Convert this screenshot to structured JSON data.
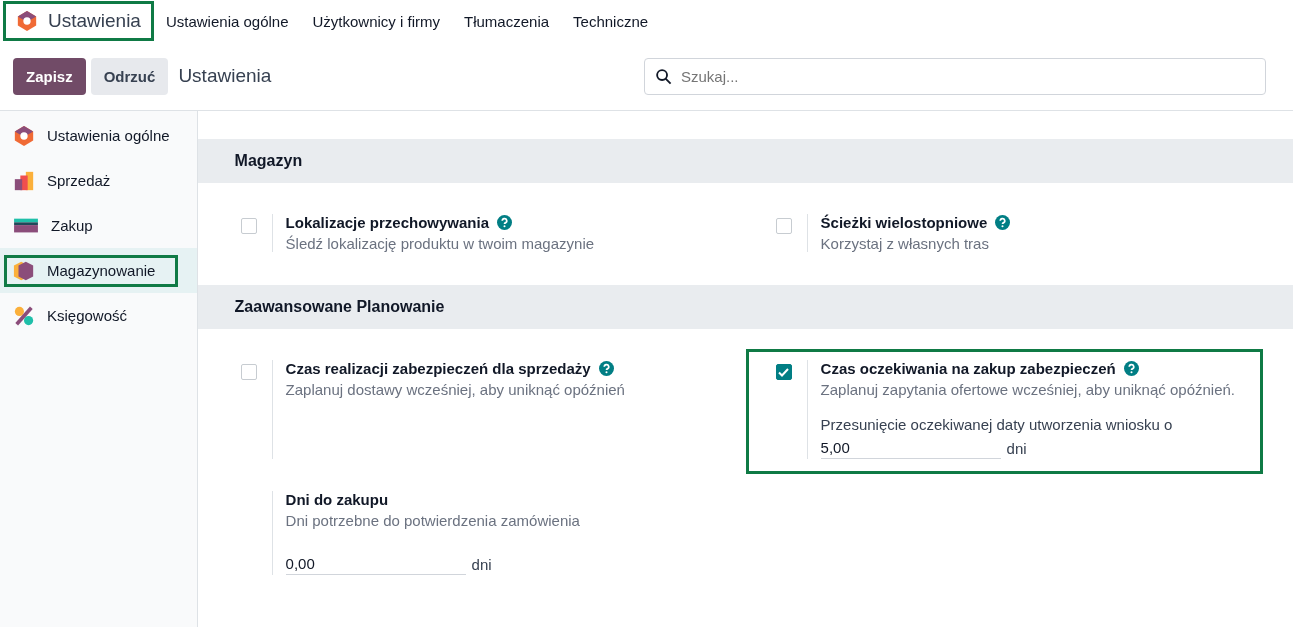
{
  "app": {
    "title": "Ustawienia",
    "highlighted": true
  },
  "menu": [
    {
      "label": "Ustawienia ogólne"
    },
    {
      "label": "Użytkownicy i firmy"
    },
    {
      "label": "Tłumaczenia"
    },
    {
      "label": "Techniczne"
    }
  ],
  "buttons": {
    "save": "Zapisz",
    "discard": "Odrzuć"
  },
  "breadcrumb": "Ustawienia",
  "search": {
    "placeholder": "Szukaj..."
  },
  "sidebar": {
    "items": [
      {
        "label": "Ustawienia ogólne",
        "kind": "general",
        "selected": false,
        "highlighted": false
      },
      {
        "label": "Sprzedaż",
        "kind": "sales",
        "selected": false,
        "highlighted": false
      },
      {
        "label": "Zakup",
        "kind": "purchase",
        "selected": false,
        "highlighted": false
      },
      {
        "label": "Magazynowanie",
        "kind": "inventory",
        "selected": true,
        "highlighted": true
      },
      {
        "label": "Księgowość",
        "kind": "accounting",
        "selected": false,
        "highlighted": false
      }
    ]
  },
  "sections": [
    {
      "title": "Magazyn",
      "settings": [
        {
          "kind": "checkbox",
          "checked": false,
          "highlighted": false,
          "help": true,
          "title": "Lokalizacje przechowywania",
          "description": "Śledź lokalizację produktu w twoim magazynie"
        },
        {
          "kind": "checkbox",
          "checked": false,
          "highlighted": false,
          "help": true,
          "title": "Ścieżki wielostopniowe",
          "description": "Korzystaj z własnych tras"
        }
      ]
    },
    {
      "title": "Zaawansowane Planowanie",
      "settings": [
        {
          "kind": "checkbox",
          "checked": false,
          "highlighted": false,
          "help": true,
          "title": "Czas realizacji zabezpieczeń dla sprzedaży",
          "description": "Zaplanuj dostawy wcześniej, aby uniknąć opóźnień"
        },
        {
          "kind": "checkbox",
          "checked": true,
          "highlighted": true,
          "help": true,
          "title": "Czas oczekiwania na zakup zabezpieczeń",
          "description": "Zaplanuj zapytania ofertowe wcześniej, aby uniknąć opóźnień.",
          "input": {
            "label": "Przesunięcie oczekiwanej daty utworzenia wniosku o",
            "value": "5,00",
            "unit": "dni"
          }
        },
        {
          "kind": "field",
          "highlighted": false,
          "help": false,
          "title": "Dni do zakupu",
          "description": "Dni potrzebne do potwierdzenia zamówienia",
          "input": {
            "value": "0,00",
            "unit": "dni"
          }
        }
      ]
    }
  ]
}
